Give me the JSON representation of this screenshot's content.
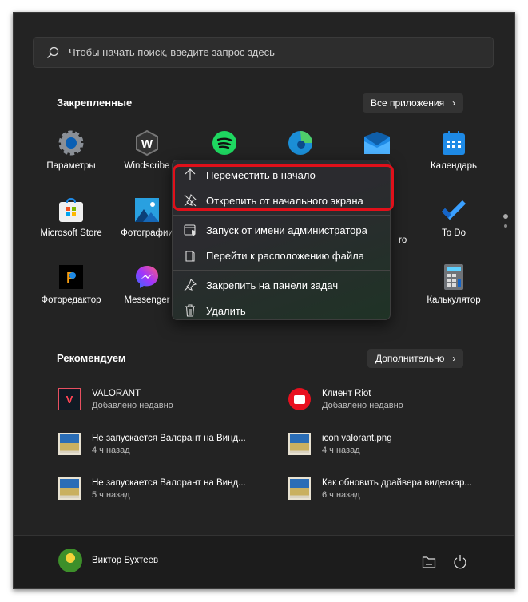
{
  "search": {
    "placeholder": "Чтобы начать поиск, введите запрос здесь",
    "icon": "search-icon"
  },
  "pinned": {
    "title": "Закрепленные",
    "all_apps": "Все приложения",
    "apps": [
      {
        "label": "Параметры",
        "icon": "settings-gear-icon"
      },
      {
        "label": "Windscribe",
        "icon": "windscribe-icon"
      },
      {
        "label": "",
        "icon": "spotify-icon"
      },
      {
        "label": "",
        "icon": "edge-icon"
      },
      {
        "label": "",
        "icon": "mail-icon"
      },
      {
        "label": "Календарь",
        "icon": "calendar-icon"
      },
      {
        "label": "Microsoft Store",
        "icon": "store-icon"
      },
      {
        "label": "Фотографии",
        "icon": "photos-icon"
      },
      {
        "label": "",
        "icon": "hidden"
      },
      {
        "label": "",
        "icon": "hidden"
      },
      {
        "label": "ro",
        "icon": "hidden"
      },
      {
        "label": "To Do",
        "icon": "todo-icon"
      },
      {
        "label": "Фоторедактор",
        "icon": "photo-editor-icon"
      },
      {
        "label": "Messenger",
        "icon": "messenger-icon"
      },
      {
        "label": "",
        "icon": "hidden"
      },
      {
        "label": "",
        "icon": "hidden"
      },
      {
        "label": "",
        "icon": "hidden"
      },
      {
        "label": "Калькулятор",
        "icon": "calculator-icon"
      }
    ]
  },
  "context_menu": {
    "items": [
      {
        "label": "Переместить в начало",
        "icon": "arrow-up-icon"
      },
      {
        "label": "Открепить от начального экрана",
        "icon": "unpin-icon"
      },
      {
        "label": "Запуск от имени администратора",
        "icon": "admin-shield-icon"
      },
      {
        "label": "Перейти к расположению файла",
        "icon": "file-location-icon"
      },
      {
        "label": "Закрепить на панели задач",
        "icon": "pin-icon"
      },
      {
        "label": "Удалить",
        "icon": "trash-icon"
      }
    ],
    "highlight_color": "#e0101a"
  },
  "recommended": {
    "title": "Рекомендуем",
    "more": "Дополнительно",
    "items": [
      {
        "name": "VALORANT",
        "sub": "Добавлено недавно",
        "icon": "valorant-icon"
      },
      {
        "name": "Клиент Riot",
        "sub": "Добавлено недавно",
        "icon": "riot-icon"
      },
      {
        "name": "Не запускается Валорант на Винд...",
        "sub": "4 ч назад",
        "icon": "image-file-icon"
      },
      {
        "name": "icon valorant.png",
        "sub": "4 ч назад",
        "icon": "image-file-icon"
      },
      {
        "name": "Не запускается Валорант на Винд...",
        "sub": "5 ч назад",
        "icon": "image-file-icon"
      },
      {
        "name": "Как обновить драйвера видеокар...",
        "sub": "6 ч назад",
        "icon": "image-file-icon"
      }
    ]
  },
  "footer": {
    "user": "Виктор Бухтеев"
  }
}
